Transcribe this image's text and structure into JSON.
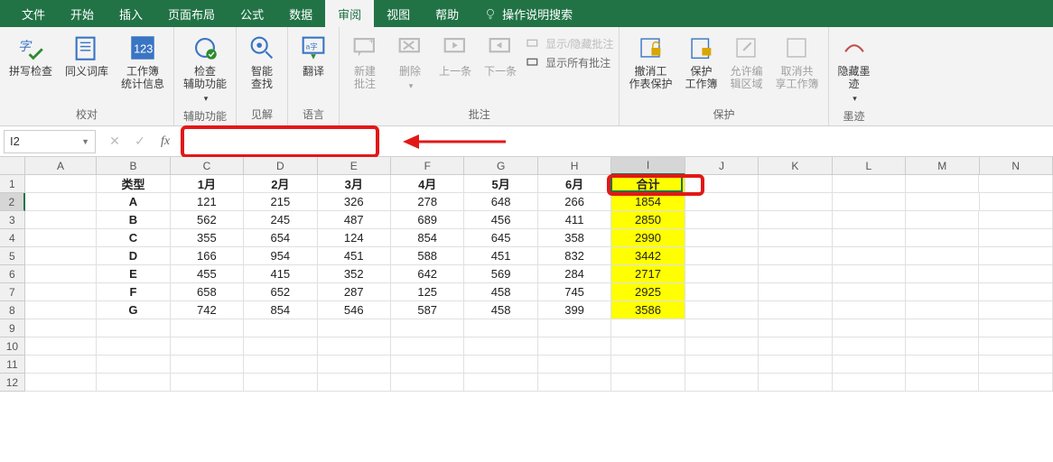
{
  "tabs": {
    "file": "文件",
    "home": "开始",
    "insert": "插入",
    "layout": "页面布局",
    "formulas": "公式",
    "data": "数据",
    "review": "审阅",
    "view": "视图",
    "help": "帮助",
    "search": "操作说明搜索"
  },
  "ribbon": {
    "proofing": {
      "label": "校对",
      "spelling": "拼写检查",
      "thesaurus": "同义词库",
      "workbook_stats": "工作簿\n统计信息"
    },
    "accessibility": {
      "label": "辅助功能",
      "check": "检查\n辅助功能"
    },
    "insights": {
      "label": "见解",
      "smart_lookup": "智能\n查找"
    },
    "language": {
      "label": "语言",
      "translate": "翻译"
    },
    "comments": {
      "label": "批注",
      "new": "新建\n批注",
      "delete": "删除",
      "prev": "上一条",
      "next": "下一条",
      "show_hide": "显示/隐藏批注",
      "show_all": "显示所有批注"
    },
    "protect": {
      "label": "保护",
      "unprotect_sheet": "撤消工\n作表保护",
      "protect_workbook": "保护\n工作簿",
      "allow_edit": "允许编\n辑区域",
      "unshare": "取消共\n享工作簿"
    },
    "ink": {
      "label": "墨迹",
      "hide_ink": "隐藏墨\n迹"
    }
  },
  "namebox": "I2",
  "columns": [
    "A",
    "B",
    "C",
    "D",
    "E",
    "F",
    "G",
    "H",
    "I",
    "J",
    "K",
    "L",
    "M",
    "N"
  ],
  "row_headers": [
    1,
    2,
    3,
    4,
    5,
    6,
    7,
    8,
    9,
    10,
    11,
    12
  ],
  "headers": {
    "type": "类型",
    "m1": "1月",
    "m2": "2月",
    "m3": "3月",
    "m4": "4月",
    "m5": "5月",
    "m6": "6月",
    "total": "合计"
  },
  "data_rows": [
    {
      "type": "A",
      "v": [
        121,
        215,
        326,
        278,
        648,
        266
      ],
      "total": 1854
    },
    {
      "type": "B",
      "v": [
        562,
        245,
        487,
        689,
        456,
        411
      ],
      "total": 2850
    },
    {
      "type": "C",
      "v": [
        355,
        654,
        124,
        854,
        645,
        358
      ],
      "total": 2990
    },
    {
      "type": "D",
      "v": [
        166,
        954,
        451,
        588,
        451,
        832
      ],
      "total": 3442
    },
    {
      "type": "E",
      "v": [
        455,
        415,
        352,
        642,
        569,
        284
      ],
      "total": 2717
    },
    {
      "type": "F",
      "v": [
        658,
        652,
        287,
        125,
        458,
        745
      ],
      "total": 2925
    },
    {
      "type": "G",
      "v": [
        742,
        854,
        546,
        587,
        458,
        399
      ],
      "total": 3586
    }
  ]
}
